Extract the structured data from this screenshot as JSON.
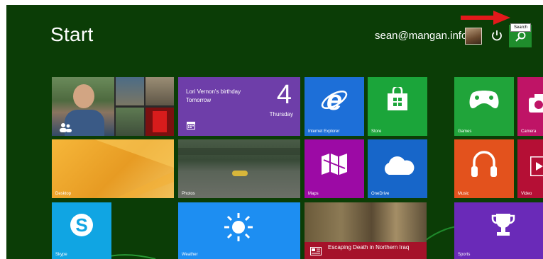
{
  "header": {
    "title": "Start",
    "user_email": "sean@mangan.info",
    "search_tooltip": "Search"
  },
  "tiles": {
    "calendar": {
      "event": "Lori Vernon's birthday",
      "when": "Tomorrow",
      "day": "4",
      "weekday": "Thursday"
    },
    "internet_explorer": {
      "label": "Internet Explorer"
    },
    "store": {
      "label": "Store"
    },
    "games": {
      "label": "Games"
    },
    "camera": {
      "label": "Camera"
    },
    "desktop": {
      "label": "Desktop"
    },
    "photos": {
      "label": "Photos"
    },
    "maps": {
      "label": "Maps"
    },
    "onedrive": {
      "label": "OneDrive"
    },
    "music": {
      "label": "Music"
    },
    "video": {
      "label": "Video"
    },
    "skype": {
      "label": "Skype"
    },
    "weather": {
      "label": "Weather"
    },
    "news": {
      "headline": "Escaping Death in Northern Iraq"
    },
    "sports": {
      "label": "Sports"
    }
  },
  "colors": {
    "background": "#0b3d06",
    "accent_green": "#1f8d2c",
    "annotation_arrow": "#e3191b"
  }
}
